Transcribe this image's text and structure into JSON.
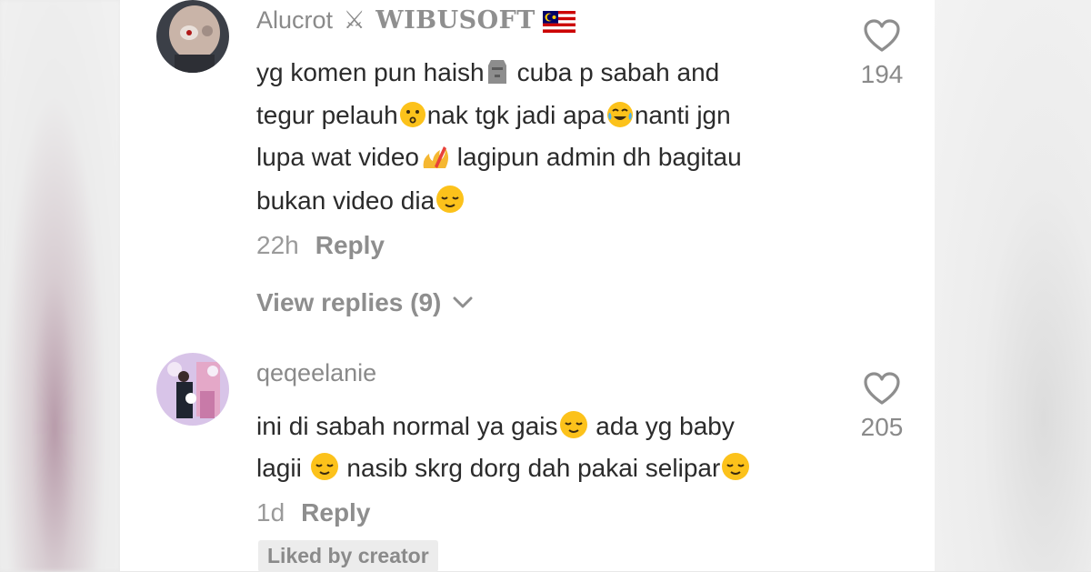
{
  "comments": [
    {
      "username": "Alucrot",
      "username_brand": "WIBUSOFT",
      "lines": [
        [
          "yg komen pun haish",
          "cuba p sabah and"
        ],
        [
          "tegur pelauh",
          "nak tgk jadi apa",
          "nanti jgn"
        ],
        [
          "lupa wat video",
          " lagipun admin dh bagitau"
        ],
        [
          "bukan video dia"
        ]
      ],
      "time": "22h",
      "reply": "Reply",
      "view_replies": "View replies (9)",
      "likes": "194"
    },
    {
      "username": "qeqeelanie",
      "lines": [
        [
          "ini di sabah normal ya gais",
          " ada yg baby"
        ],
        [
          "lagii ",
          " nasib skrg dorg dah pakai selipar"
        ]
      ],
      "time": "1d",
      "reply": "Reply",
      "badge": "Liked by creator",
      "likes": "205"
    }
  ],
  "icons": {
    "like": "heart-outline-icon",
    "expand": "chevron-down-icon",
    "emojis": [
      "moai-emoji",
      "kissing-face-emoji",
      "tears-of-joy-emoji",
      "sparkle-fire-emoji",
      "relieved-face-emoji",
      "malaysia-flag-emoji"
    ]
  },
  "colors": {
    "username": "#8a8a8a",
    "text": "#2b2b2b",
    "meta": "#9a9a9a",
    "badge_bg": "#ececec"
  }
}
